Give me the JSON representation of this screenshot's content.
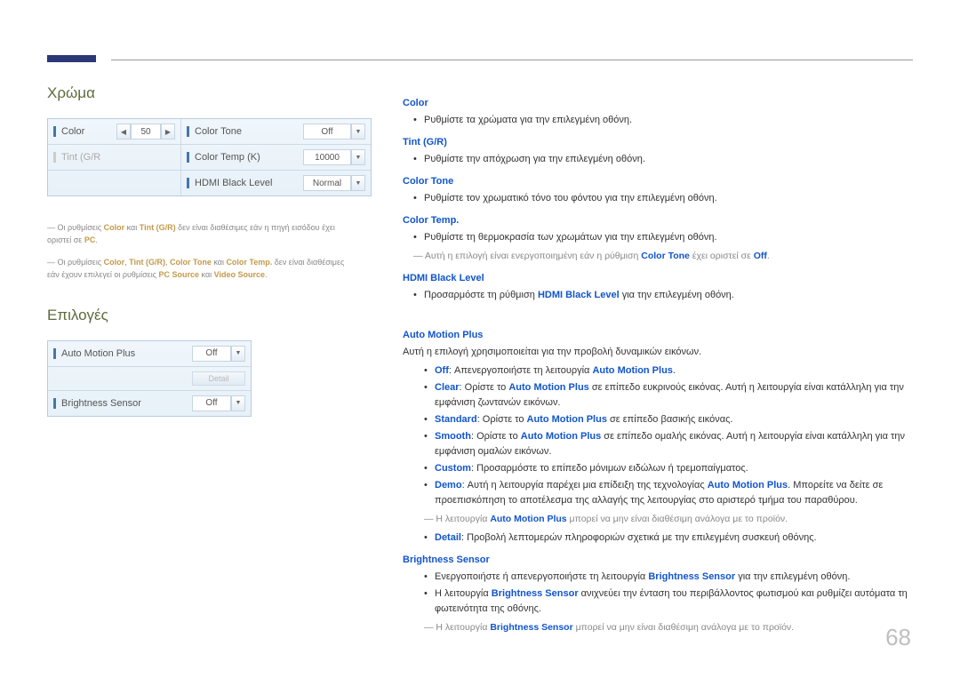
{
  "page_number": "68",
  "left": {
    "section1_title": "Χρώμα",
    "panel1": {
      "r1c1_label": "Color",
      "r1c1_value": "50",
      "r1c2_label": "Color Tone",
      "r1c2_value": "Off",
      "r2c1_label": "Tint (G/R",
      "r2c2_label": "Color Temp (K)",
      "r2c2_value": "10000",
      "r3c2_label": "HDMI Black Level",
      "r3c2_value": "Normal"
    },
    "note1_pre": "Οι ρυθμίσεις ",
    "note1_t1": "Color",
    "note1_mid1": " και ",
    "note1_t2": "Tint (G/R)",
    "note1_post": " δεν είναι διαθέσιμες εάν η πηγή εισόδου έχει οριστεί σε ",
    "note1_t3": "PC",
    "note1_end": ".",
    "note2_pre": "Οι ρυθμίσεις ",
    "note2_t1": "Color",
    "note2_c1": ", ",
    "note2_t2": "Tint (G/R)",
    "note2_c2": ", ",
    "note2_t3": "Color Tone",
    "note2_mid": " και ",
    "note2_t4": "Color Temp.",
    "note2_post": " δεν είναι διαθέσιμες εάν έχουν επιλεγεί οι ρυθμίσεις ",
    "note2_t5": "PC Source",
    "note2_and": " και ",
    "note2_t6": "Video Source",
    "note2_end": ".",
    "section2_title": "Επιλογές",
    "panel2": {
      "r1_label": "Auto Motion Plus",
      "r1_value": "Off",
      "detail_label": "Detail",
      "r3_label": "Brightness Sensor",
      "r3_value": "Off"
    }
  },
  "right": {
    "color_hd": "Color",
    "color_txt": "Ρυθμίστε τα χρώματα για την επιλεγμένη οθόνη.",
    "tint_hd": "Tint (G/R)",
    "tint_txt": "Ρυθμίστε την απόχρωση για την επιλεγμένη οθόνη.",
    "ctone_hd": "Color Tone",
    "ctone_txt": "Ρυθμίστε τον χρωματικό τόνο του φόντου για την επιλεγμένη οθόνη.",
    "ctemp_hd": "Color Temp.",
    "ctemp_txt": "Ρυθμίστε τη θερμοκρασία των χρωμάτων για την επιλεγμένη οθόνη.",
    "ctemp_note_pre": "― Αυτή η επιλογή είναι ενεργοποιημένη εάν η ρύθμιση ",
    "ctemp_note_t1": "Color Tone",
    "ctemp_note_mid": " έχει οριστεί σε ",
    "ctemp_note_t2": "Off",
    "ctemp_note_end": ".",
    "hbl_hd": "HDMI Black Level",
    "hbl_pre": "Προσαρμόστε τη ρύθμιση ",
    "hbl_t": "HDMI Black Level",
    "hbl_post": " για την επιλεγμένη οθόνη.",
    "amp_hd": "Auto Motion Plus",
    "amp_intro": "Αυτή η επιλογή χρησιμοποιείται για την προβολή δυναμικών εικόνων.",
    "amp_off_t": "Off",
    "amp_off_txt": ": Απενεργοποιήστε τη λειτουργία ",
    "amp_off_t2": "Auto Motion Plus",
    "amp_off_end": ".",
    "amp_clear_t": "Clear",
    "amp_clear_txt": ": Ορίστε το ",
    "amp_clear_t2": "Auto Motion Plus",
    "amp_clear_post": " σε επίπεδο ευκρινούς εικόνας. Αυτή η λειτουργία είναι κατάλληλη για την εμφάνιση ζωντανών εικόνων.",
    "amp_std_t": "Standard",
    "amp_std_txt": ": Ορίστε το ",
    "amp_std_t2": "Auto Motion Plus",
    "amp_std_post": " σε επίπεδο βασικής εικόνας.",
    "amp_smooth_t": "Smooth",
    "amp_smooth_txt": ": Ορίστε το ",
    "amp_smooth_t2": "Auto Motion Plus",
    "amp_smooth_post": " σε επίπεδο ομαλής εικόνας. Αυτή η λειτουργία είναι κατάλληλη για την εμφάνιση ομαλών εικόνων.",
    "amp_custom_t": "Custom",
    "amp_custom_txt": ": Προσαρμόστε το επίπεδο μόνιμων ειδώλων ή τρεμοπαίγματος.",
    "amp_demo_t": "Demo",
    "amp_demo_txt": ": Αυτή η λειτουργία παρέχει μια επίδειξη της τεχνολογίας ",
    "amp_demo_t2": "Auto Motion Plus",
    "amp_demo_post": ". Μπορείτε να δείτε σε προεπισκόπηση το αποτέλεσμα της αλλαγής της λειτουργίας στο αριστερό τμήμα του παραθύρου.",
    "amp_note_pre": "― Η λειτουργία ",
    "amp_note_t": "Auto Motion Plus",
    "amp_note_post": " μπορεί να μην είναι διαθέσιμη ανάλογα με το προϊόν.",
    "amp_detail_t": "Detail",
    "amp_detail_txt": ": Προβολή λεπτομερών πληροφοριών σχετικά με την επιλεγμένη συσκευή οθόνης.",
    "bs_hd": "Brightness Sensor",
    "bs1_pre": "Ενεργοποιήστε ή απενεργοποιήστε τη λειτουργία ",
    "bs1_t": "Brightness Sensor",
    "bs1_post": " για την επιλεγμένη οθόνη.",
    "bs2_pre": "Η λειτουργία ",
    "bs2_t": "Brightness Sensor",
    "bs2_post": " ανιχνεύει την ένταση του περιβάλλοντος φωτισμού και ρυθμίζει αυτόματα τη φωτεινότητα της οθόνης.",
    "bs_note_pre": "― Η λειτουργία ",
    "bs_note_t": "Brightness Sensor",
    "bs_note_post": " μπορεί να μην είναι διαθέσιμη ανάλογα με το προϊόν."
  }
}
